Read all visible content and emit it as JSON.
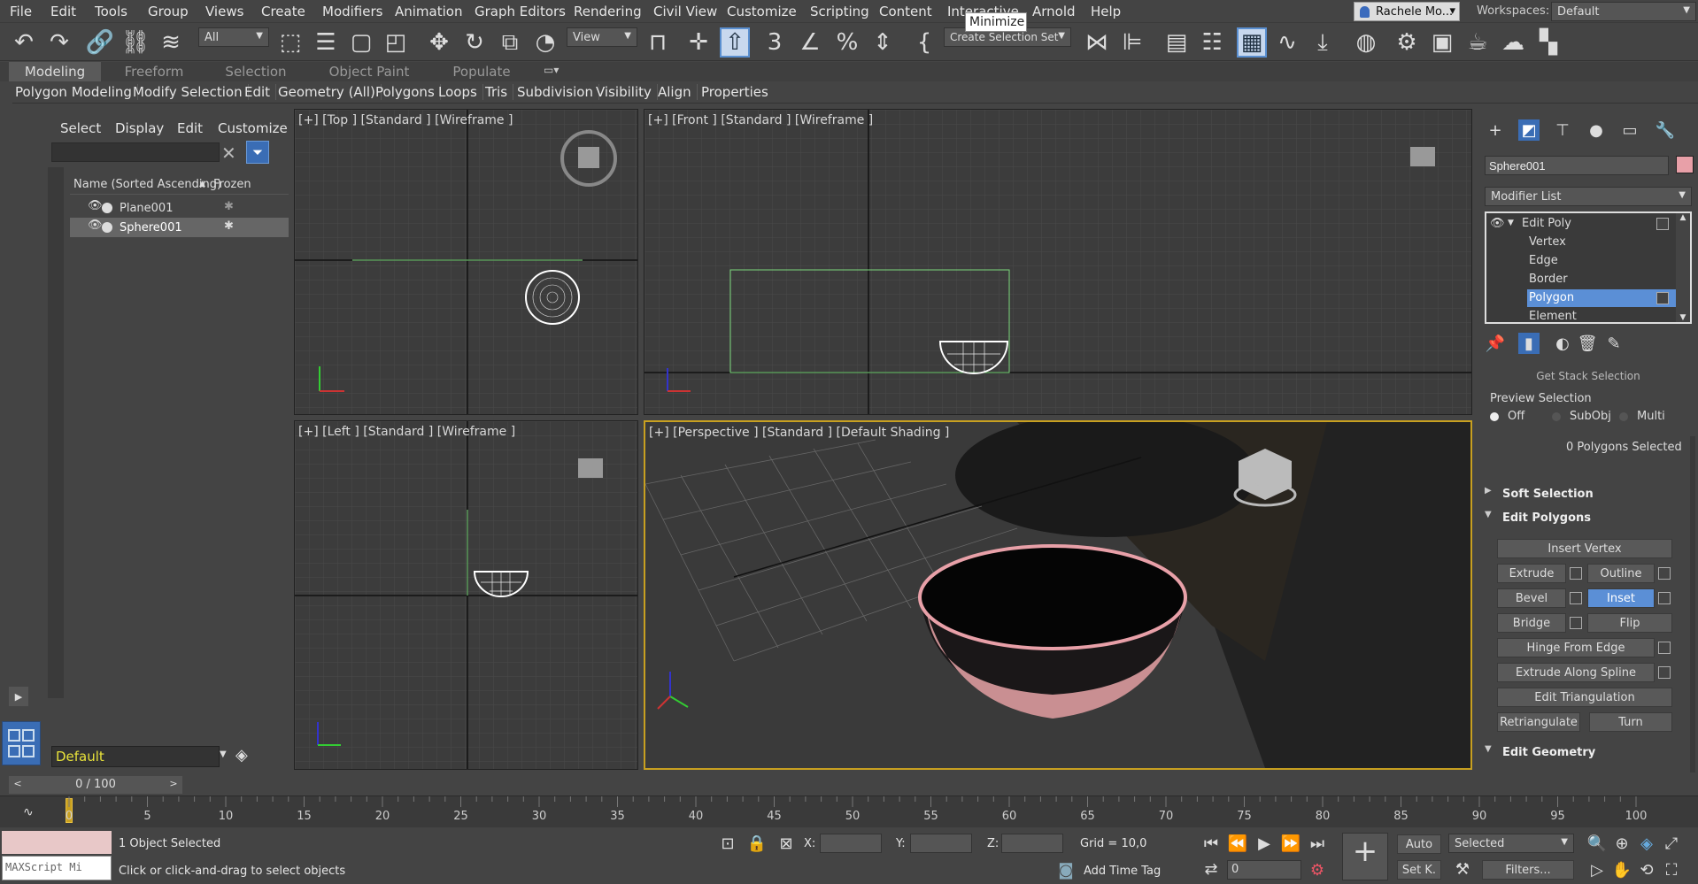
{
  "menu": [
    "File",
    "Edit",
    "Tools",
    "Group",
    "Views",
    "Create",
    "Modifiers",
    "Animation",
    "Graph Editors",
    "Rendering",
    "Civil View",
    "Customize",
    "Scripting",
    "Content",
    "Interactive",
    "Arnold",
    "Help"
  ],
  "user": "Rachele Mo...",
  "workspaces_label": "Workspaces:",
  "workspace": "Default",
  "tooltip": "Minimize",
  "toolbar": {
    "filter": "All",
    "refcoord": "View",
    "selset": "Create Selection Set"
  },
  "ribbon_tabs": [
    "Modeling",
    "Freeform",
    "Selection",
    "Object Paint",
    "Populate"
  ],
  "ribbon_items": [
    "Polygon Modeling",
    "Modify Selection",
    "Edit",
    "Geometry (All)",
    "Polygons",
    "Loops",
    "Tris",
    "Subdivision",
    "Visibility",
    "Align",
    "Properties"
  ],
  "scene": {
    "menu": [
      "Select",
      "Display",
      "Edit",
      "Customize"
    ],
    "col_name": "Name (Sorted Ascending)",
    "col_frozen": "Frozen",
    "rows": [
      "Plane001",
      "Sphere001"
    ],
    "layer": "Default"
  },
  "viewports": {
    "top": "[+] [Top ] [Standard ] [Wireframe ]",
    "front": "[+] [Front ] [Standard ] [Wireframe ]",
    "left": "[+] [Left ] [Standard ] [Wireframe ]",
    "persp": "[+] [Perspective ] [Standard ] [Default Shading ]"
  },
  "cmd": {
    "object_name": "Sphere001",
    "object_color": "#e8a0a8",
    "modifier_list": "Modifier List",
    "stack": [
      "Edit Poly",
      "Vertex",
      "Edge",
      "Border",
      "Polygon",
      "Element"
    ],
    "get_stack": "Get Stack Selection",
    "preview": "Preview Selection",
    "preview_opts": [
      "Off",
      "SubObj",
      "Multi"
    ],
    "selected_info": "0 Polygons Selected",
    "soft_selection": "Soft Selection",
    "edit_polygons": "Edit Polygons",
    "insert_vertex": "Insert Vertex",
    "extrude": "Extrude",
    "outline": "Outline",
    "bevel": "Bevel",
    "inset": "Inset",
    "bridge": "Bridge",
    "flip": "Flip",
    "hinge": "Hinge From Edge",
    "extrude_spline": "Extrude Along Spline",
    "edit_tri": "Edit Triangulation",
    "retriangulate": "Retriangulate",
    "turn": "Turn",
    "edit_geometry": "Edit Geometry"
  },
  "time": {
    "slider": "0 / 100",
    "ticks": [
      "0",
      "5",
      "10",
      "15",
      "20",
      "25",
      "30",
      "35",
      "40",
      "45",
      "50",
      "55",
      "60",
      "65",
      "70",
      "75",
      "80",
      "85",
      "90",
      "95",
      "100"
    ]
  },
  "status": {
    "maxscript": "MAXScript Mi",
    "selected": "1 Object Selected",
    "prompt": "Click or click-and-drag to select objects",
    "x": "X:",
    "y": "Y:",
    "z": "Z:",
    "grid": "Grid = 10,0",
    "add_time_tag": "Add Time Tag",
    "auto": "Auto",
    "setk": "Set K.",
    "selected_dd": "Selected",
    "filters": "Filters...",
    "frame": "0"
  }
}
